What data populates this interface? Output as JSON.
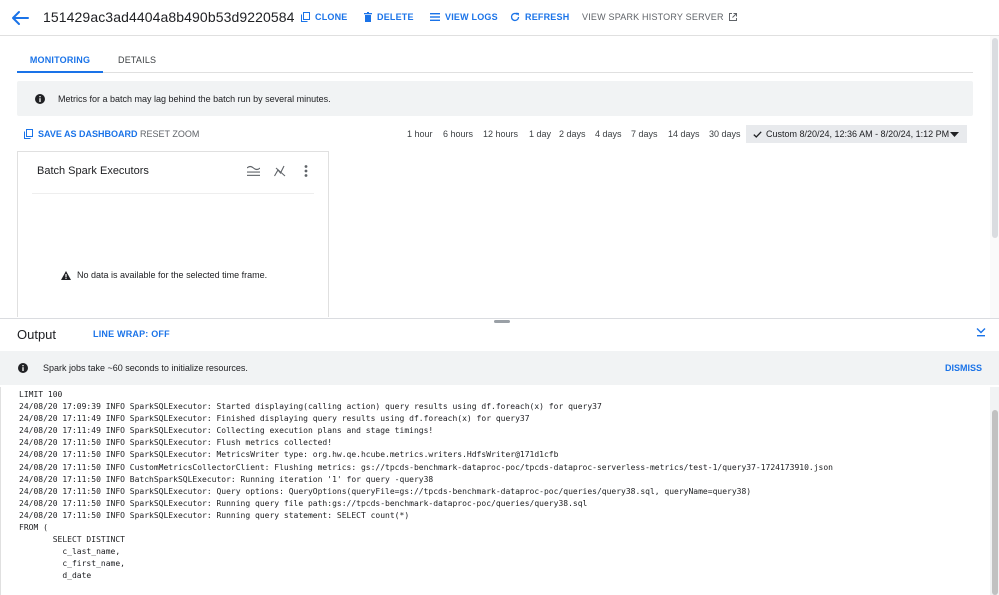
{
  "header": {
    "batch_id": "151429ac3ad4404a8b490b53d9220584",
    "clone": "CLONE",
    "delete": "DELETE",
    "view_logs": "VIEW LOGS",
    "refresh": "REFRESH",
    "history": "VIEW SPARK HISTORY SERVER"
  },
  "tabs": [
    {
      "label": "MONITORING",
      "active": true
    },
    {
      "label": "DETAILS",
      "active": false
    }
  ],
  "info_banner": "Metrics for a batch may lag behind the batch run by several minutes.",
  "toolbar": {
    "save_dashboard": "SAVE AS DASHBOARD",
    "reset_zoom": "RESET ZOOM",
    "ranges": [
      "1 hour",
      "6 hours",
      "12 hours",
      "1 day",
      "2 days",
      "4 days",
      "7 days",
      "14 days",
      "30 days"
    ],
    "custom_range": "Custom 8/20/24, 12:36 AM - 8/20/24, 1:12 PM"
  },
  "chart_card": {
    "title": "Batch Spark Executors",
    "no_data": "No data is available for the selected time frame."
  },
  "output": {
    "title": "Output",
    "line_wrap": "LINE WRAP: OFF",
    "banner": "Spark jobs take ~60 seconds to initialize resources.",
    "dismiss": "DISMISS",
    "log": [
      "LIMIT 100",
      "24/08/20 17:09:39 INFO SparkSQLExecutor: Started displaying(calling action) query results using df.foreach(x) for query37",
      "24/08/20 17:11:49 INFO SparkSQLExecutor: Finished displaying query results using df.foreach(x) for query37",
      "24/08/20 17:11:49 INFO SparkSQLExecutor: Collecting execution plans and stage timings!",
      "24/08/20 17:11:50 INFO SparkSQLExecutor: Flush metrics collected!",
      "24/08/20 17:11:50 INFO SparkSQLExecutor: MetricsWriter type: org.hw.qe.hcube.metrics.writers.HdfsWriter@171d1cfb",
      "24/08/20 17:11:50 INFO CustomMetricsCollectorClient: Flushing metrics: gs://tpcds-benchmark-dataproc-poc/tpcds-dataproc-serverless-metrics/test-1/query37-1724173910.json",
      "24/08/20 17:11:50 INFO BatchSparkSQLExecutor: Running iteration '1' for query -query38",
      "24/08/20 17:11:50 INFO SparkSQLExecutor: Query options: QueryOptions(queryFile=gs://tpcds-benchmark-dataproc-poc/queries/query38.sql, queryName=query38)",
      "24/08/20 17:11:50 INFO SparkSQLExecutor: Running query file path:gs://tpcds-benchmark-dataproc-poc/queries/query38.sql",
      "24/08/20 17:11:50 INFO SparkSQLExecutor: Running query statement: SELECT count(*)",
      "FROM (",
      "       SELECT DISTINCT",
      "         c_last_name,",
      "         c_first_name,",
      "         d_date"
    ]
  },
  "colors": {
    "accent": "#1a73e8",
    "banner_bg": "#f1f3f4",
    "text": "#202124",
    "muted": "#5f6368"
  }
}
